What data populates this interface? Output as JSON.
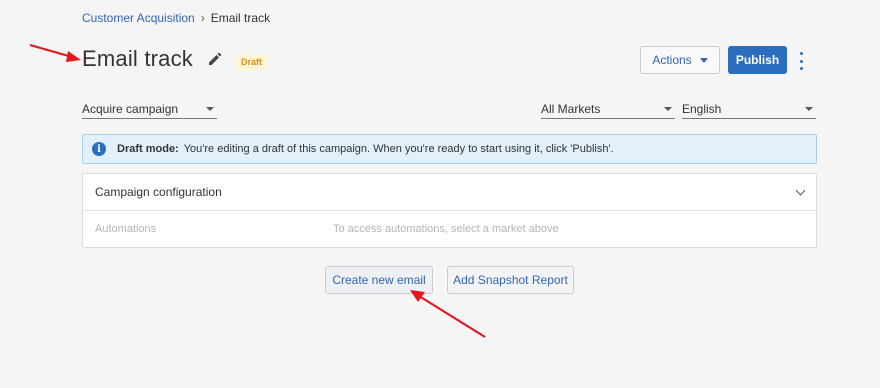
{
  "breadcrumb": {
    "parent": "Customer Acquisition",
    "separator": "›",
    "current": "Email track"
  },
  "header": {
    "title": "Email track",
    "status_badge": "Draft",
    "actions_label": "Actions",
    "publish_label": "Publish"
  },
  "filters": {
    "campaign": "Acquire campaign",
    "markets": "All Markets",
    "language": "English"
  },
  "banner": {
    "strong": "Draft mode:",
    "text": "You're editing a draft of this campaign. When you're ready to start using it, click 'Publish'."
  },
  "panel": {
    "header": "Campaign configuration",
    "row_label": "Automations",
    "row_value": "To access automations, select a market above"
  },
  "buttons": {
    "create_email": "Create new email",
    "add_snapshot": "Add Snapshot Report"
  },
  "colors": {
    "accent": "#2a6ebd",
    "link": "#3366b3",
    "badge_bg": "#fff4d6",
    "badge_text": "#d9901a",
    "banner_bg": "#e1f0fb",
    "annotation": "#e8141c"
  },
  "icons": {
    "edit": "pencil-icon",
    "actions_caret": "caret-down-icon",
    "more": "kebab-menu-icon",
    "info": "info-icon",
    "panel_toggle": "chevron-down-icon"
  }
}
